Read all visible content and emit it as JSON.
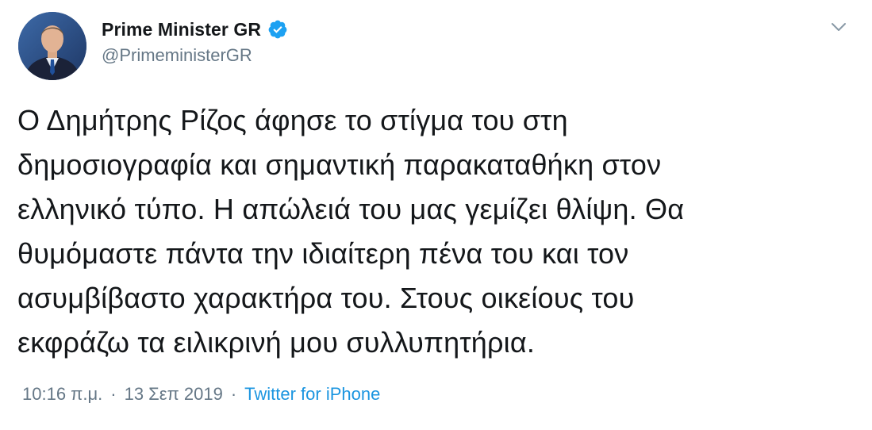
{
  "author": {
    "display_name": "Prime Minister GR",
    "handle": "@PrimeministerGR",
    "verified": true,
    "avatar_icon": "profile-photo"
  },
  "tweet": {
    "text": "Ο Δημήτρης Ρίζος άφησε το στίγμα του στη\nδημοσιογραφία και σημαντική παρακαταθήκη στον\nελληνικό τύπο. Η απώλειά του μας γεμίζει θλίψη. Θα\nθυμόμαστε πάντα την ιδιαίτερη πένα του και τον\nασυμβίβαστο χαρακτήρα του. Στους οικείους του\nεκφράζω τα ειλικρινή μου συλλυπητήρια."
  },
  "meta": {
    "time": "10:16 π.μ.",
    "separator": "·",
    "date": "13 Σεπ 2019",
    "source": "Twitter for iPhone"
  },
  "icons": {
    "verified": "verified-badge-icon",
    "menu": "chevron-down-icon"
  },
  "colors": {
    "name": "#14171a",
    "secondary": "#657786",
    "link": "#1b95e0",
    "verified": "#1da1f2"
  }
}
